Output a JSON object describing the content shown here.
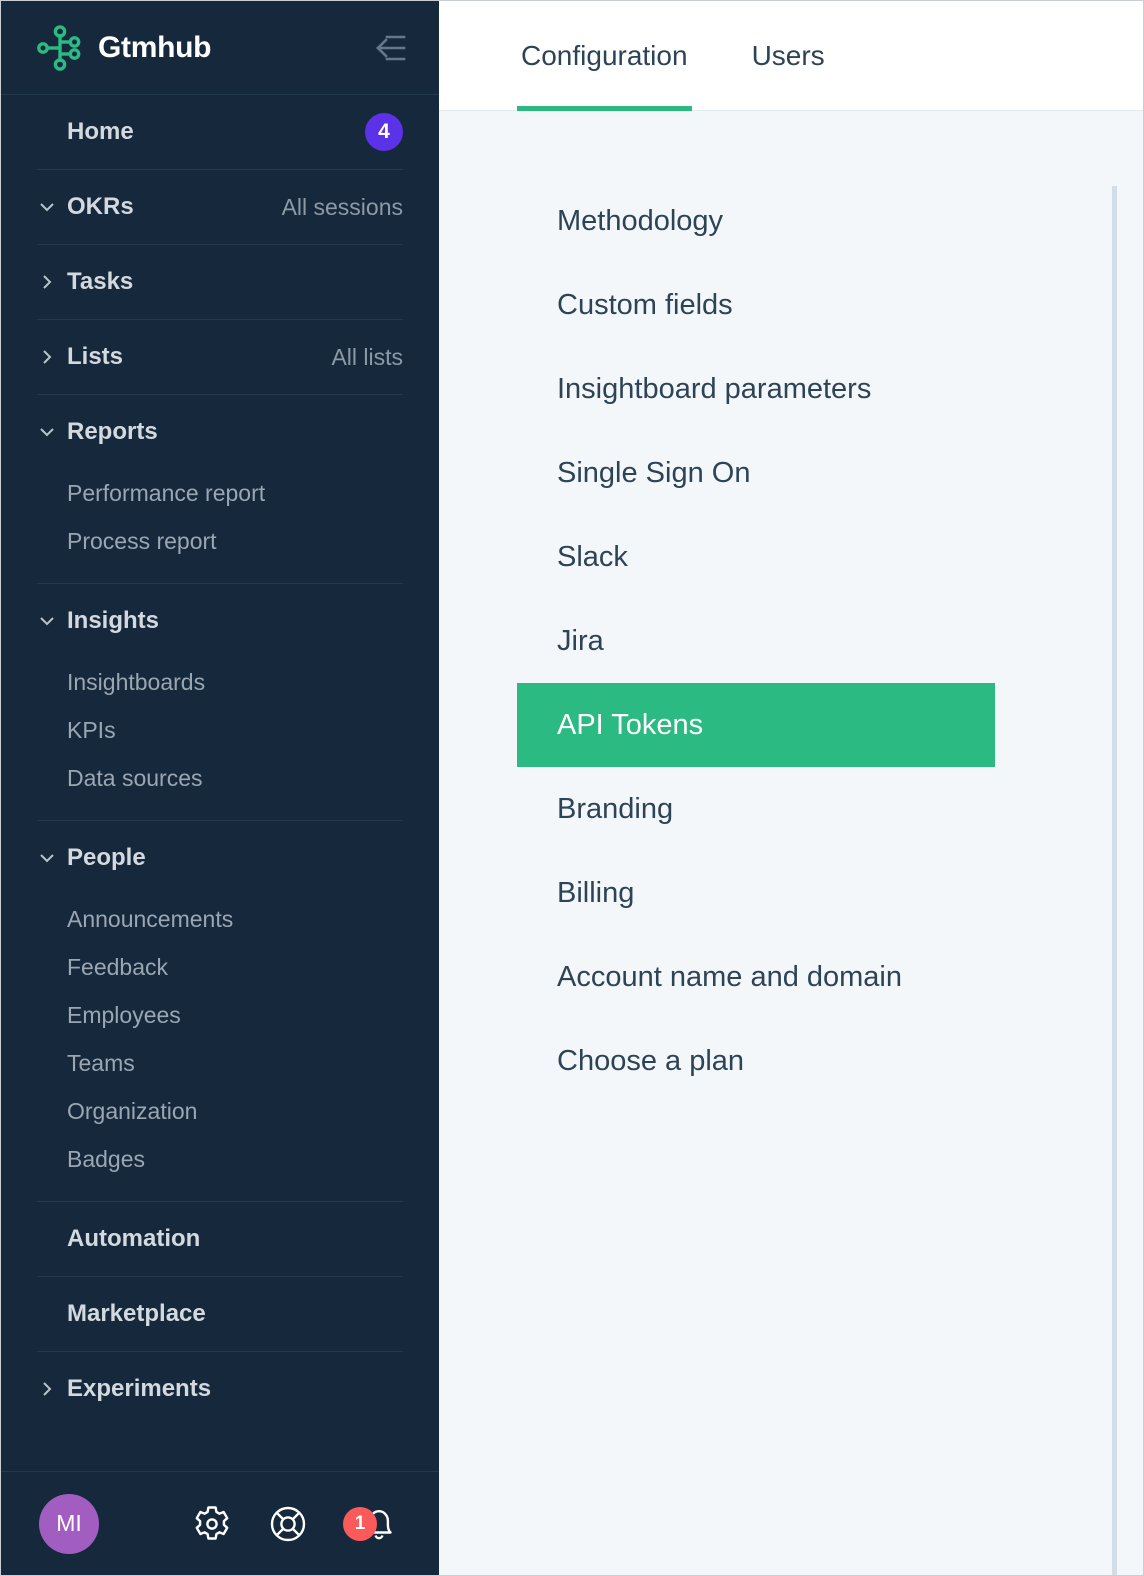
{
  "sidebar": {
    "brand": {
      "name": "Gtmhub",
      "logo_icon": "gtmhub-node-logo",
      "color": "#2bba82"
    },
    "collapse_icon": "collapse-sidebar-arrow-icon",
    "groups": [
      {
        "label": "Home",
        "chevron": "none",
        "badge": "4",
        "badge_color": "#5b32e8",
        "children": []
      },
      {
        "label": "OKRs",
        "chevron": "down",
        "aside": "All sessions",
        "children": []
      },
      {
        "label": "Tasks",
        "chevron": "right",
        "children": []
      },
      {
        "label": "Lists",
        "chevron": "right",
        "aside": "All lists",
        "children": []
      },
      {
        "label": "Reports",
        "chevron": "down",
        "children": [
          "Performance report",
          "Process report"
        ]
      },
      {
        "label": "Insights",
        "chevron": "down",
        "children": [
          "Insightboards",
          "KPIs",
          "Data sources"
        ]
      },
      {
        "label": "People",
        "chevron": "down",
        "children": [
          "Announcements",
          "Feedback",
          "Employees",
          "Teams",
          "Organization",
          "Badges"
        ]
      },
      {
        "label": "Automation",
        "chevron": "none",
        "children": []
      },
      {
        "label": "Marketplace",
        "chevron": "none",
        "children": []
      },
      {
        "label": "Experiments",
        "chevron": "right",
        "children": []
      }
    ],
    "footer": {
      "avatar_initials": "MI",
      "avatar_color": "#a25dc0",
      "settings_icon": "gear-icon",
      "help_icon": "lifebuoy-icon",
      "notifications_icon": "bell-icon",
      "notifications_count": "1",
      "notifications_color": "#fb5a5a"
    }
  },
  "main": {
    "tabs": [
      {
        "label": "Configuration",
        "active": true
      },
      {
        "label": "Users",
        "active": false
      }
    ],
    "active_tab_underline_color": "#2bb981",
    "settings": {
      "selected": "API Tokens",
      "selected_bg": "#2bba82",
      "items": [
        "Methodology",
        "Custom fields",
        "Insightboard parameters",
        "Single Sign On",
        "Slack",
        "Jira",
        "API Tokens",
        "Branding",
        "Billing",
        "Account name and domain",
        "Choose a plan"
      ]
    }
  }
}
